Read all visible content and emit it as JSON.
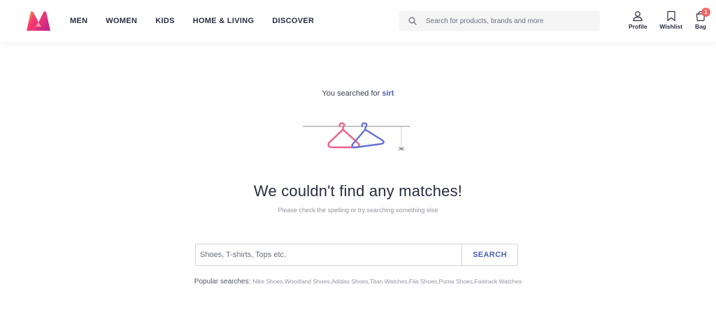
{
  "header": {
    "nav": [
      "MEN",
      "WOMEN",
      "KIDS",
      "HOME & LIVING",
      "DISCOVER"
    ],
    "search_placeholder": "Search for products, brands and more",
    "actions": {
      "profile": "Profile",
      "wishlist": "Wishlist",
      "bag": "Bag",
      "bag_count": "1"
    }
  },
  "result": {
    "searched_prefix": "You searched for",
    "searched_term": "sirt",
    "title": "We couldn't find any matches!",
    "subtitle": "Please check the spelling or try searching something else"
  },
  "bottom_search": {
    "placeholder": "Shoes, T-shirts, Tops etc.",
    "button": "SEARCH"
  },
  "popular": {
    "label": "Popular searches:",
    "items": [
      "Nike Shoes",
      "Woodland Shoes",
      "Adidas Shoes",
      "Titan Watches",
      "Fila Shoes",
      "Puma Shoes",
      "Fastrack Watches"
    ]
  },
  "colors": {
    "accent": "#4a5fb5",
    "badge": "#f16565",
    "hanger_pink": "#ee5f87",
    "hanger_blue": "#6470d6"
  }
}
